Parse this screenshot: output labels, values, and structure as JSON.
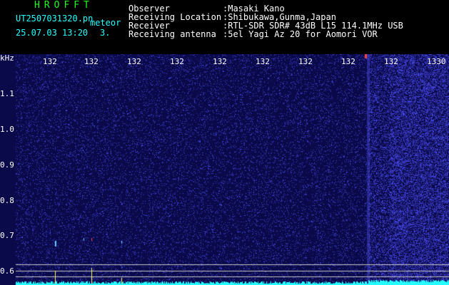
{
  "header": {
    "app_name": "HROFFT",
    "filename": "UT2507031320.pn",
    "tag": "meteor",
    "datetime": "25.07.03 13:20",
    "count": "3.",
    "fields": [
      {
        "label": "Observer",
        "value": ":Masaki Kano"
      },
      {
        "label": "Receiving Location",
        "value": ":Shibukawa,Gunma,Japan"
      },
      {
        "label": "Receiver",
        "value": ":RTL-SDR SDR# 43dB L15 114.1MHz USB"
      },
      {
        "label": "Receiving antenna",
        "value": ":5el Yagi Az 20 for Aomori VOR"
      }
    ]
  },
  "spectrogram": {
    "unit_label": "kHz",
    "time_ticks": [
      "132",
      "132",
      "132",
      "132",
      "132",
      "132",
      "132",
      "132",
      "132",
      "1330"
    ],
    "freq_ticks": [
      "1.1",
      "1.0",
      "0.9",
      "0.8",
      "0.7",
      "0.6"
    ],
    "colors": {
      "background": "#0a0a4a",
      "noise": "#3a3aff",
      "line": "#c8c8c8",
      "cyan": "#25ffff"
    }
  }
}
